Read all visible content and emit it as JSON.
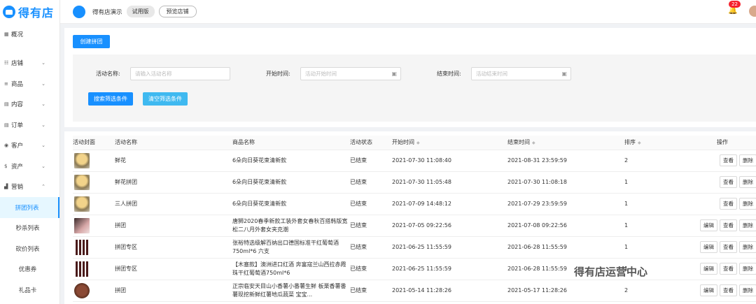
{
  "brand": {
    "name": "得有店"
  },
  "sidebar": {
    "items": [
      {
        "label": "概况",
        "icon": "grid-icon"
      },
      {
        "label": "店铺",
        "icon": "store-icon"
      },
      {
        "label": "商品",
        "icon": "goods-icon"
      },
      {
        "label": "内容",
        "icon": "content-icon"
      },
      {
        "label": "订单",
        "icon": "order-icon"
      },
      {
        "label": "客户",
        "icon": "customer-icon"
      },
      {
        "label": "资产",
        "icon": "dollar-icon"
      },
      {
        "label": "营销",
        "icon": "chart-icon"
      }
    ],
    "sub_items": [
      "拼团列表",
      "秒杀列表",
      "砍价列表",
      "优惠券",
      "礼品卡"
    ]
  },
  "topbar": {
    "shop_name": "得有店演示",
    "trial": "试用版",
    "preview": "预览店铺",
    "notifications": "22"
  },
  "toolbar": {
    "create": "创建拼团"
  },
  "filter": {
    "name_label": "活动名称:",
    "name_placeholder": "请输入活动名称",
    "start_label": "开始时间:",
    "start_placeholder": "活动开始时间",
    "end_label": "结束时间:",
    "end_placeholder": "活动结束时间",
    "search": "搜索筛选条件",
    "clear": "清空筛选条件"
  },
  "table": {
    "headers": [
      "活动封面",
      "活动名称",
      "商品名称",
      "活动状态",
      "开始时间",
      "结束时间",
      "排序",
      "操作"
    ],
    "rows": [
      {
        "thumb": "flower",
        "name": "鲜花",
        "goods": "6朵向日葵花束清新款",
        "status": "已结束",
        "start": "2021-07-30 11:08:40",
        "end": "2021-08-31 23:59:59",
        "order": "2",
        "ops": [
          "查看",
          "删除"
        ]
      },
      {
        "thumb": "flower",
        "name": "鲜花拼团",
        "goods": "6朵向日葵花束清新款",
        "status": "已结束",
        "start": "2021-07-30 11:05:48",
        "end": "2021-07-30 11:08:18",
        "order": "1",
        "ops": [
          "查看",
          "删除"
        ]
      },
      {
        "thumb": "flower",
        "name": "三人拼团",
        "goods": "6朵向日葵花束清新款",
        "status": "已结束",
        "start": "2021-07-09 14:48:12",
        "end": "2021-07-29 23:59:59",
        "order": "1",
        "ops": [
          "查看",
          "删除"
        ]
      },
      {
        "thumb": "clothes",
        "name": "拼团",
        "goods": "唐狮2020春季新款工装外套女春秋百搭韩版宽松二八月外套女夹克潮",
        "status": "已结束",
        "start": "2021-07-05 09:22:56",
        "end": "2021-07-08 09:22:56",
        "order": "1",
        "ops": [
          "编辑",
          "查看",
          "删除"
        ]
      },
      {
        "thumb": "wine",
        "name": "拼团专区",
        "goods": "张裕特选级解百纳出口德国标准干红葡萄酒750ml*6 六支",
        "status": "已结束",
        "start": "2021-06-25 11:55:59",
        "end": "2021-06-28 11:55:59",
        "order": "1",
        "ops": [
          "编辑",
          "查看",
          "删除"
        ]
      },
      {
        "thumb": "wine",
        "name": "拼团专区",
        "goods": "【木塞款】澳洲进口红酒 奔富寇兰山西拉赤霞珠干红葡萄酒750ml*6",
        "status": "已结束",
        "start": "2021-06-25 11:55:59",
        "end": "2021-06-28 11:55:59",
        "order": "1",
        "ops": [
          "编辑",
          "查看",
          "删除"
        ]
      },
      {
        "thumb": "fruit",
        "name": "拼团",
        "goods": "正宗临安天目山小香薯小番薯生鲜 板栗香薯番薯现挖新鲜红薯地瓜蔬菜 宝宝...",
        "status": "已结束",
        "start": "2021-05-14 11:28:26",
        "end": "2021-05-17 11:28:26",
        "order": "2",
        "ops": [
          "编辑",
          "查看",
          "删除"
        ]
      }
    ]
  },
  "watermark": "得有店运营中心"
}
